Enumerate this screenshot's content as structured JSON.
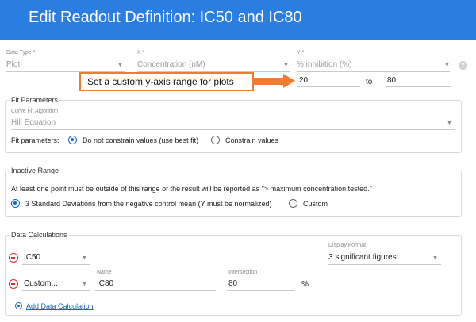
{
  "header": {
    "title": "Edit Readout Definition: IC50 and IC80"
  },
  "top_row": {
    "data_type_label": "Data Type *",
    "data_type_value": "Plot",
    "x_label": "X *",
    "x_value": "Concentration (nM)",
    "y_label": "Y *",
    "y_value": "% inhibition (%)",
    "y_min": "20",
    "to_label": "to",
    "y_max": "80",
    "help_glyph": "?"
  },
  "callout": {
    "text": "Set a custom y-axis range for plots",
    "color": "#ed7d31"
  },
  "fit_parameters": {
    "title": "Fit Parameters",
    "algorithm_label": "Curve Fit Algorithm",
    "algorithm_value": "Hill Equation",
    "params_label": "Fit parameters:",
    "option_best_fit": "Do not constrain values (use best fit)",
    "option_constrain": "Constrain values",
    "selected": "best_fit"
  },
  "inactive_range": {
    "title": "Inactive Range",
    "description": "At least one point must be outside of this range or the result will be reported as \"> maximum concentration tested.\"",
    "option_std": "3 Standard Deviations from the negative control mean (Y must be normalized)",
    "option_custom": "Custom",
    "selected": "std"
  },
  "data_calculations": {
    "title": "Data Calculations",
    "row1_calc": "IC50",
    "display_format_label": "Display Format",
    "display_format_value": "3 significant figures",
    "row2_calc": "Custom...",
    "name_label": "Name",
    "name_value": "IC80",
    "intersection_label": "Intersection",
    "intersection_value": "80",
    "percent_unit": "%",
    "add_link": "Add Data Calculation"
  },
  "colors": {
    "header": "#2a7de1",
    "accent": "#1565c0",
    "remove": "#d32f2f"
  }
}
